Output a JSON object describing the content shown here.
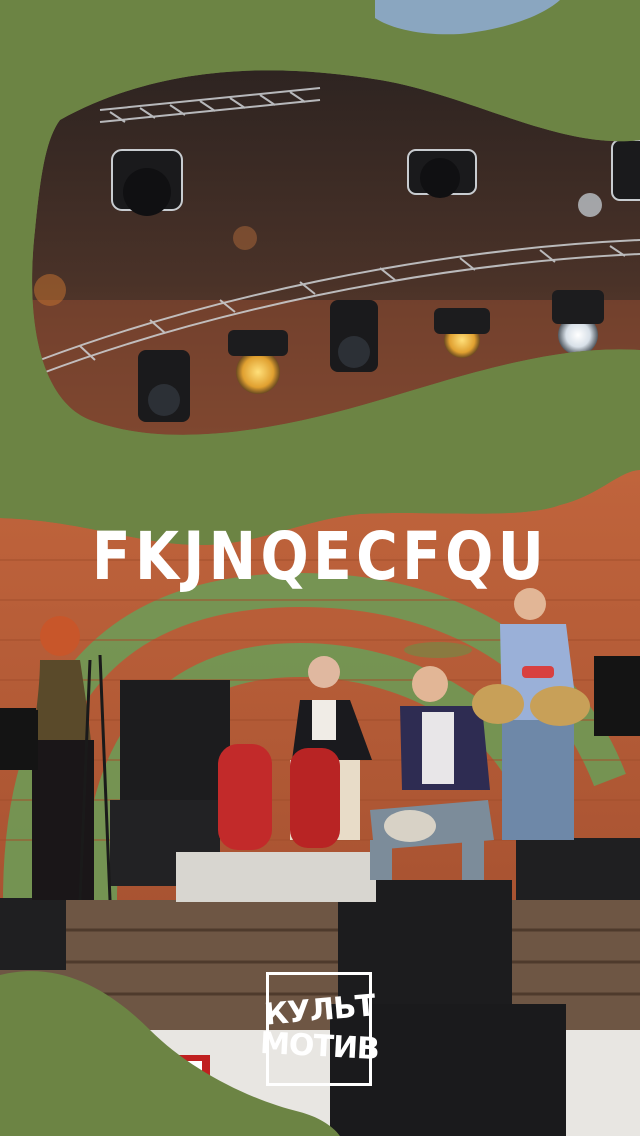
{
  "headline": "FKJNQECFQU",
  "logo": {
    "line1": "КУЛЬТ",
    "line2": "МОТИВ"
  },
  "colors": {
    "green": "#6c8444",
    "brick": "#b85a36",
    "white": "#ffffff",
    "stage_dark": "#2a2320"
  },
  "photos": [
    "stage-lights-photo",
    "band-performance-photo"
  ]
}
